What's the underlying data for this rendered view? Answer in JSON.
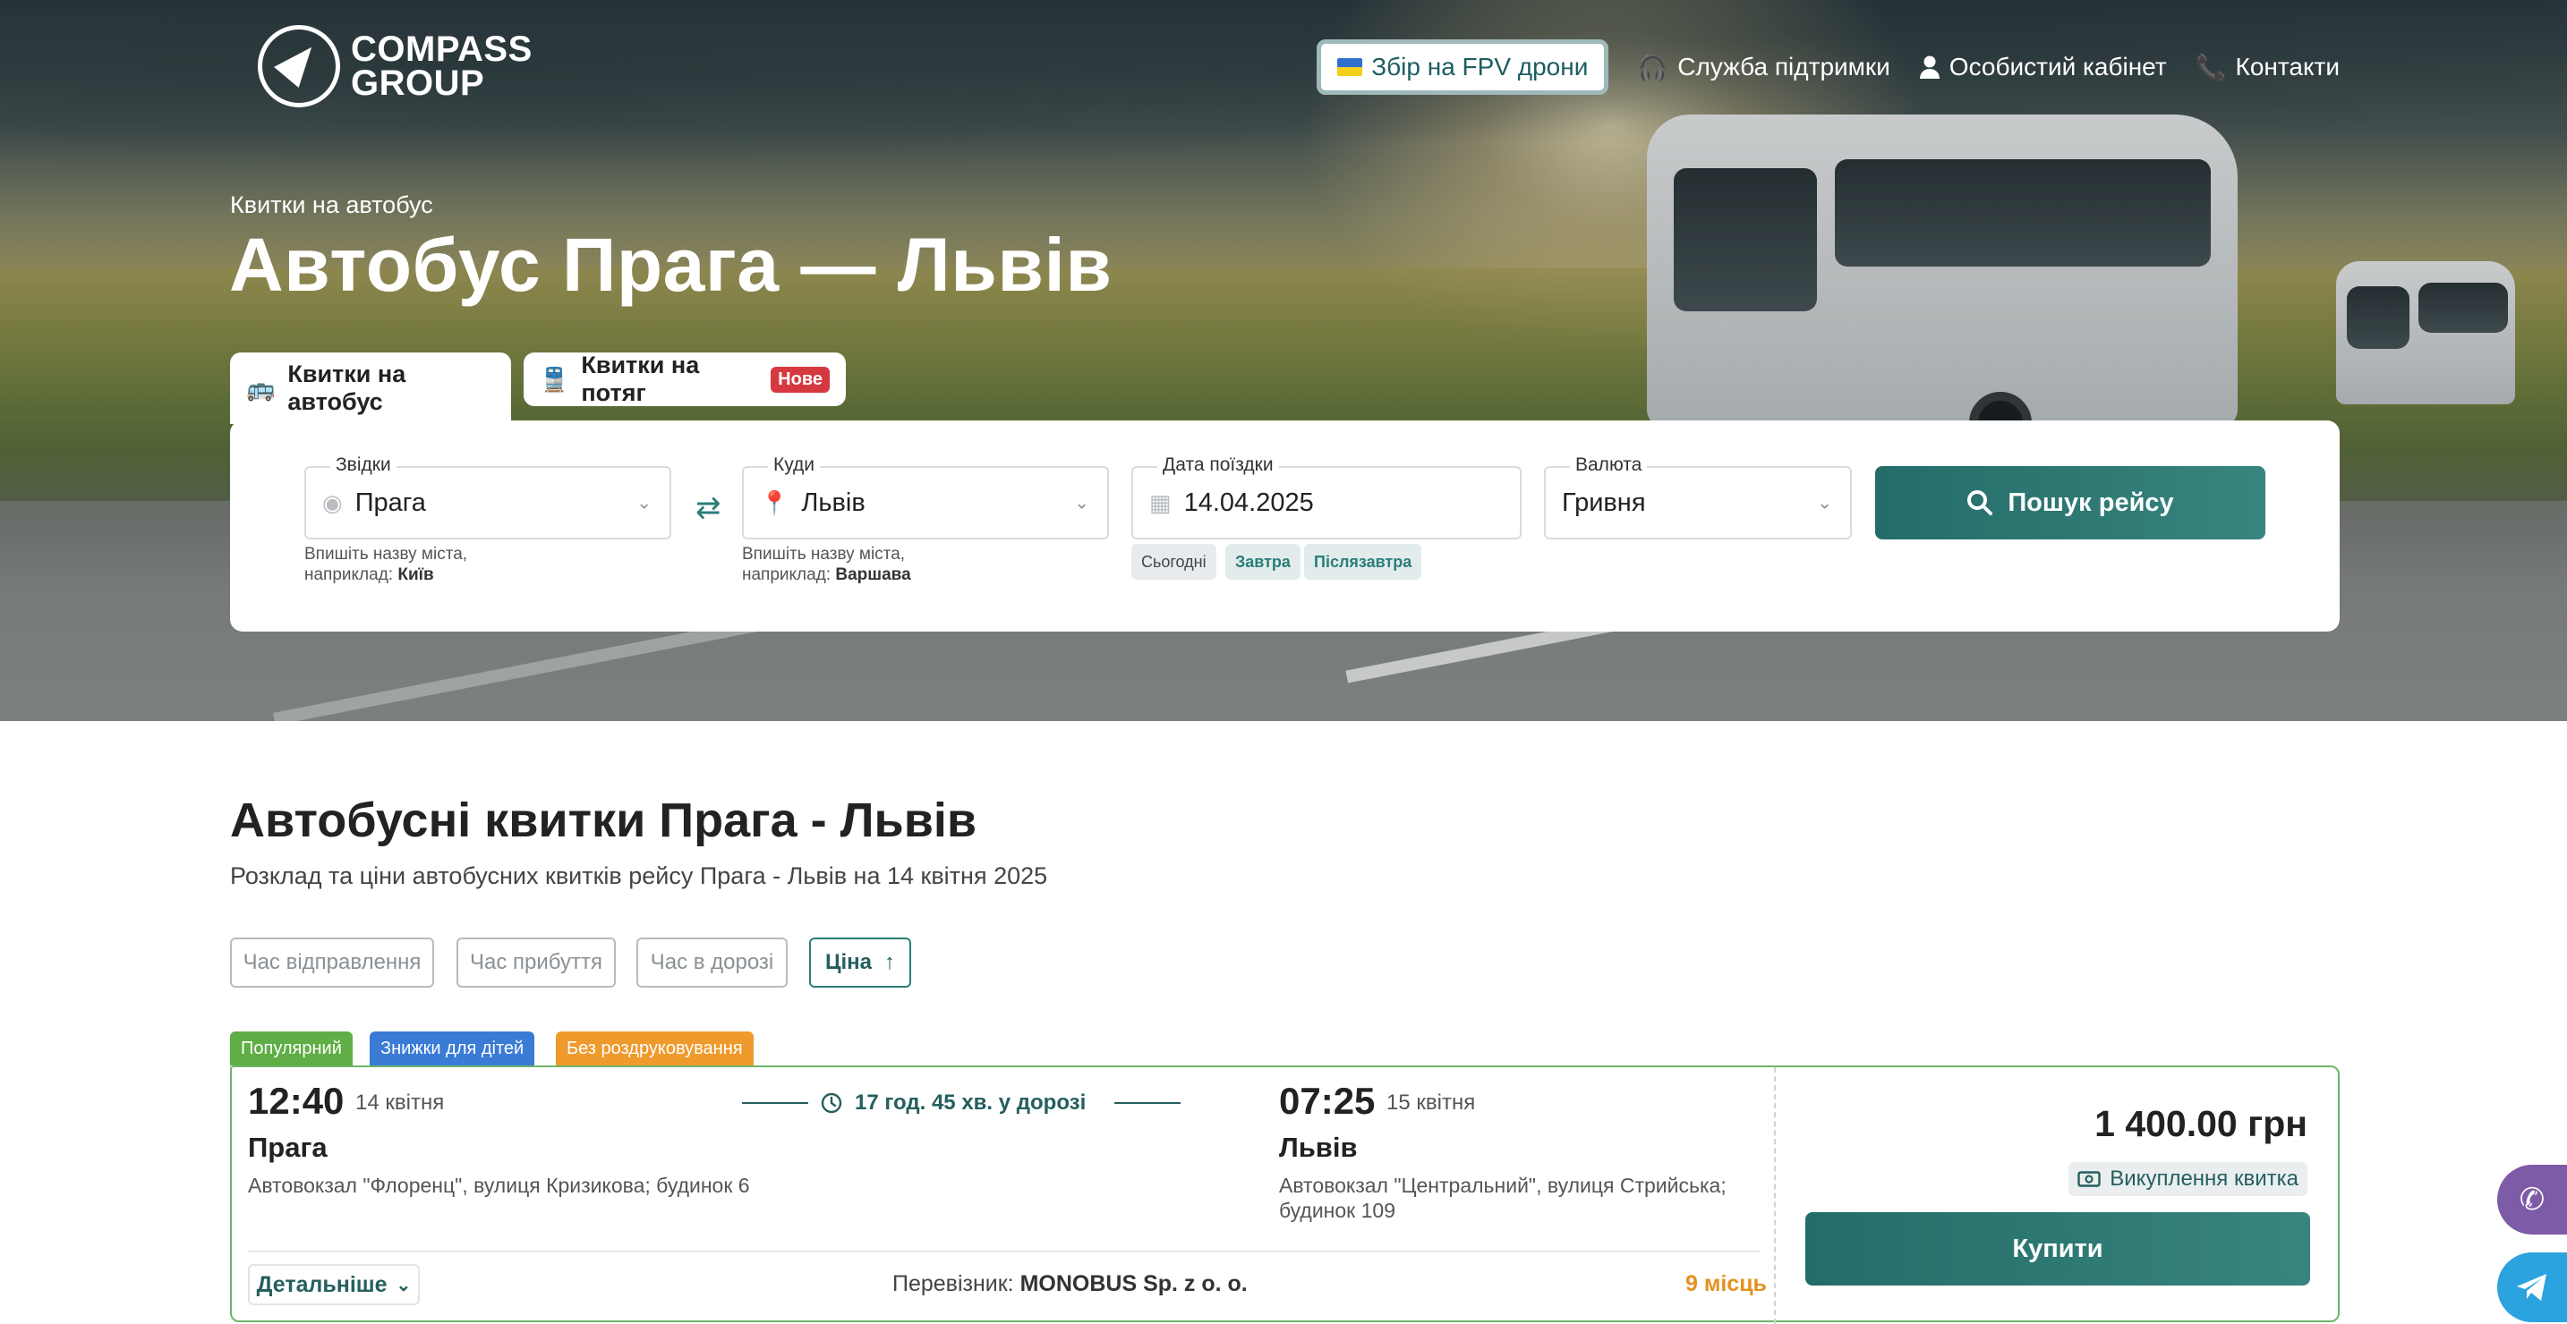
{
  "header": {
    "logo_line1": "COMPASS",
    "logo_line2": "GROUP",
    "fpv_label": "Збір на FPV дрони",
    "support_label": "Служба підтримки",
    "account_label": "Особистий кабінет",
    "contacts_label": "Контакти"
  },
  "hero": {
    "subtitle": "Квитки на автобус",
    "title": "Автобус Прага — Львів"
  },
  "tabs": {
    "bus": "Квитки на автобус",
    "train": "Квитки на потяг",
    "train_badge": "Нове"
  },
  "search": {
    "from_label": "Звідки",
    "from_value": "Прага",
    "from_hint": "Впишіть назву міста,",
    "from_hint2_prefix": "наприклад: ",
    "from_hint2_example": "Київ",
    "to_label": "Куди",
    "to_value": "Львів",
    "to_hint": "Впишіть назву міста,",
    "to_hint2_prefix": "наприклад: ",
    "to_hint2_example": "Варшава",
    "date_label": "Дата поїздки",
    "date_value": "14.04.2025",
    "chip_today": "Сьогодні",
    "chip_tomorrow": "Завтра",
    "chip_after": "Післязавтра",
    "currency_label": "Валюта",
    "currency_value": "Гривня",
    "button": "Пошук рейсу"
  },
  "content": {
    "title": "Автобусні квитки Прага - Львів",
    "description": "Розклад та ціни автобусних квитків рейсу Прага - Львів на 14 квітня 2025"
  },
  "sort": {
    "departure": "Час відправлення",
    "arrival": "Час прибуття",
    "duration": "Час в дорозі",
    "price": "Ціна",
    "price_arrow": "↑"
  },
  "tags": [
    {
      "label": "Популярний",
      "color": "#5fae45"
    },
    {
      "label": "Знижки для дітей",
      "color": "#3a7bd5"
    },
    {
      "label": "Без роздруковування",
      "color": "#ef9a2d"
    }
  ],
  "trip": {
    "dep_time": "12:40",
    "dep_date": "14 квітня",
    "dep_city": "Прага",
    "dep_address": "Автовокзал \"Флоренц\", вулиця Кризикова; будинок 6",
    "duration": "17 год. 45 хв. у дорозі",
    "arr_time": "07:25",
    "arr_date": "15 квітня",
    "arr_city": "Львів",
    "arr_address_1": "Автовокзал \"Центральний\", вулиця Стрийська;",
    "arr_address_2": "будинок 109",
    "more_label": "Детальніше",
    "carrier_prefix": "Перевізник: ",
    "carrier_name": "MONOBUS Sp. z o. o.",
    "seats": "9 місць",
    "price": "1 400.00 грн",
    "buyout": "Викуплення квитка",
    "buy_label": "Купити"
  },
  "colors": {
    "accent": "#2a7e79",
    "card_border": "#6db56a",
    "viber": "#7d5ba6",
    "telegram": "#2aa3df"
  }
}
